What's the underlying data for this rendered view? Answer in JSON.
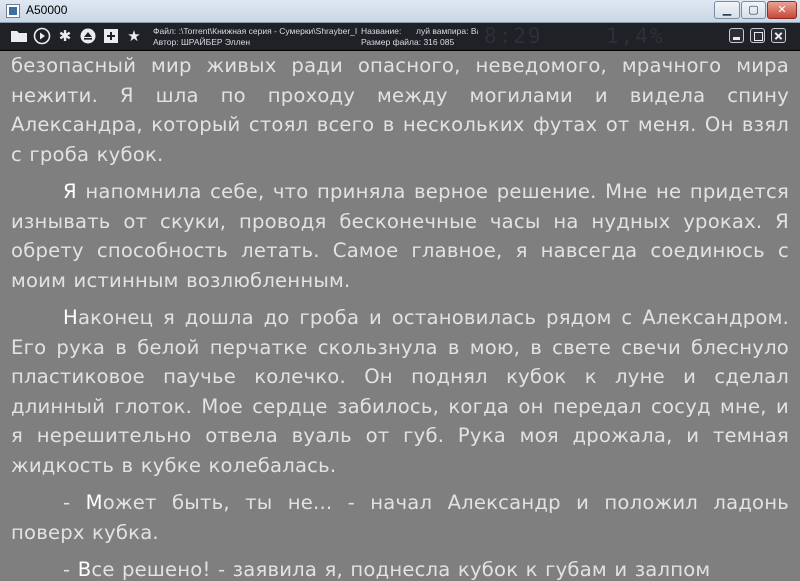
{
  "window": {
    "title": "A50000"
  },
  "toolbar": {
    "file_line": "Файл: :\\Torrent\\Книжная серия - Сумерки\\Shrayber_I",
    "author_line": "Автор: ШРАЙБЕР Эллен",
    "title_label": "Название:",
    "title_value": "луй вампира: Ва",
    "size_line": "Размер файла: 316 085",
    "clock": "8:29",
    "percent": "1,4%"
  },
  "text": {
    "p1": "безопасный мир живых ради опасного, неведомого, мрачного мира нежити. Я шла по проходу между могилами и видела спину Александра, который стоял всего в нескольких футах от меня. Он взял с гроба кубок.",
    "p2_cap": "Я",
    "p2": " напомнила себе, что приняла верное решение. Мне не придется изнывать от скуки, проводя бесконечные часы на нудных уроках. Я обрету способность летать. Самое главное, я навсегда соединюсь с моим истинным возлюбленным.",
    "p3_cap": "Н",
    "p3": "аконец я дошла до гроба и остановилась рядом с Александром. Его рука в белой перчатке скользнула в мою, в свете свечи блеснуло пластиковое паучье колечко. Он поднял кубок к луне и сделал длинный глоток. Мое сердце забилось, когда он передал сосуд мне, и я нерешительно отвела вуаль от губ. Рука моя дрожала, и темная жидкость в кубке колебалась.",
    "p4_pre": "- ",
    "p4_cap": "М",
    "p4": "ожет быть, ты не... - начал Александр и положил ладонь поверх кубка.",
    "p5_pre": "- ",
    "p5_cap": "В",
    "p5": "се решено! - заявила я, поднесла кубок к губам и залпом"
  }
}
